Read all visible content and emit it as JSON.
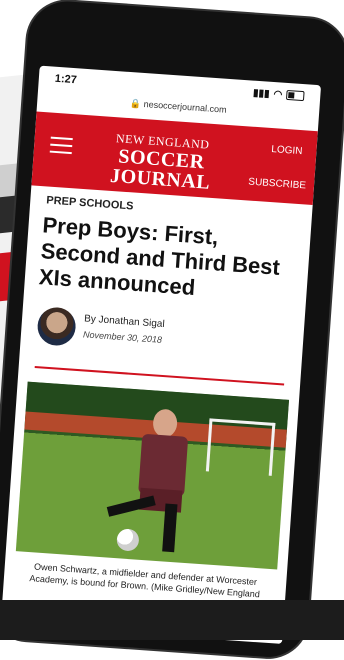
{
  "background": {
    "laptop_text1": "rd",
    "laptop_text2": "cts"
  },
  "status_bar": {
    "time": "1:27",
    "icons": [
      "signal-icon",
      "wifi-icon",
      "battery-icon"
    ]
  },
  "browser": {
    "url": "nesoccerjournal.com"
  },
  "site": {
    "logo_top": "NEW ENGLAND",
    "logo_bottom": "SOCCER JOURNAL",
    "login_label": "LOGIN",
    "subscribe_label": "SUBSCRIBE"
  },
  "article": {
    "kicker": "PREP SCHOOLS",
    "headline": "Prep Boys: First, Second and Third Best XIs announced",
    "byline_name": "By Jonathan Sigal",
    "byline_date": "November 30, 2018",
    "caption": "Owen Schwartz, a midfielder and defender at Worcester Academy, is bound for Brown. (Mike Gridley/New England"
  },
  "colors": {
    "brand_red": "#d0121f"
  }
}
